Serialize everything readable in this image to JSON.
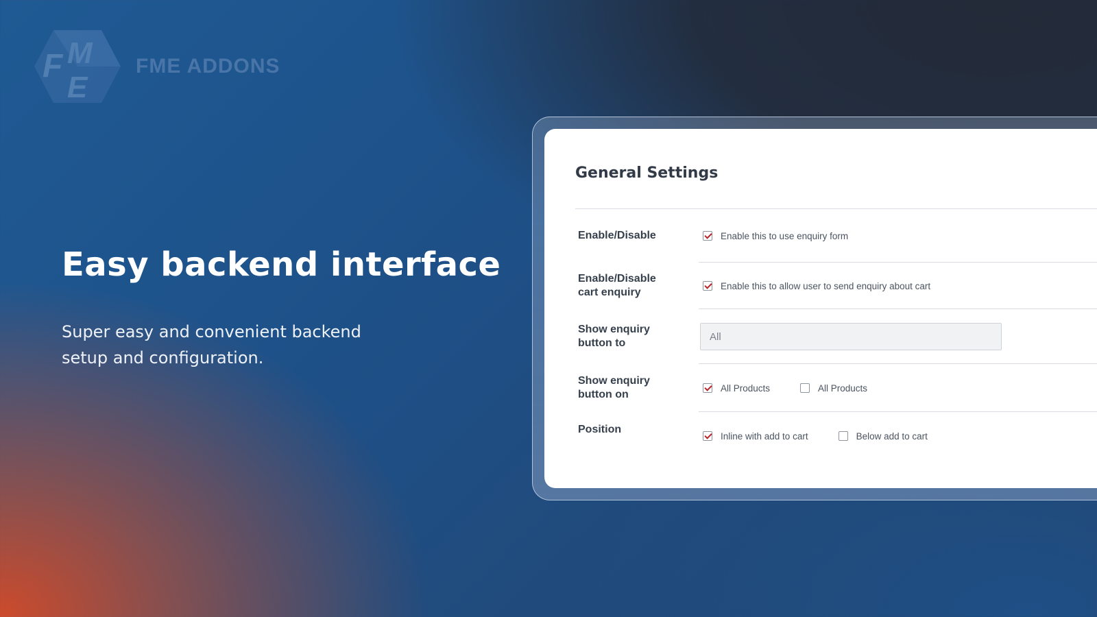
{
  "brand": {
    "name": "FME ADDONS",
    "logo_letters": "FME"
  },
  "hero": {
    "title": "Easy backend interface",
    "subtitle_line1": "Super easy and convenient backend",
    "subtitle_line2": "setup and configuration."
  },
  "settings": {
    "title": "General Settings",
    "rows": [
      {
        "label_line1": "Enable/Disable",
        "label_line2": "",
        "options": [
          {
            "text": "Enable this to use enquiry form",
            "checked": true
          }
        ]
      },
      {
        "label_line1": "Enable/Disable",
        "label_line2": "cart enquiry",
        "options": [
          {
            "text": "Enable this to allow user to send enquiry about cart",
            "checked": true
          }
        ]
      },
      {
        "label_line1": "Show enquiry",
        "label_line2": "button to",
        "select_value": "All"
      },
      {
        "label_line1": "Show enquiry",
        "label_line2": "button on",
        "options": [
          {
            "text": "All Products",
            "checked": true
          },
          {
            "text": "All Products",
            "checked": false
          }
        ]
      },
      {
        "label_line1": "Position",
        "label_line2": "",
        "options": [
          {
            "text": "Inline with add to cart",
            "checked": true
          },
          {
            "text": "Below add to cart",
            "checked": false
          }
        ]
      }
    ]
  },
  "colors": {
    "check_mark": "#b8232a",
    "panel_bg": "#ffffff",
    "accent_orange": "#d64a26",
    "accent_blue": "#1f5a94"
  }
}
